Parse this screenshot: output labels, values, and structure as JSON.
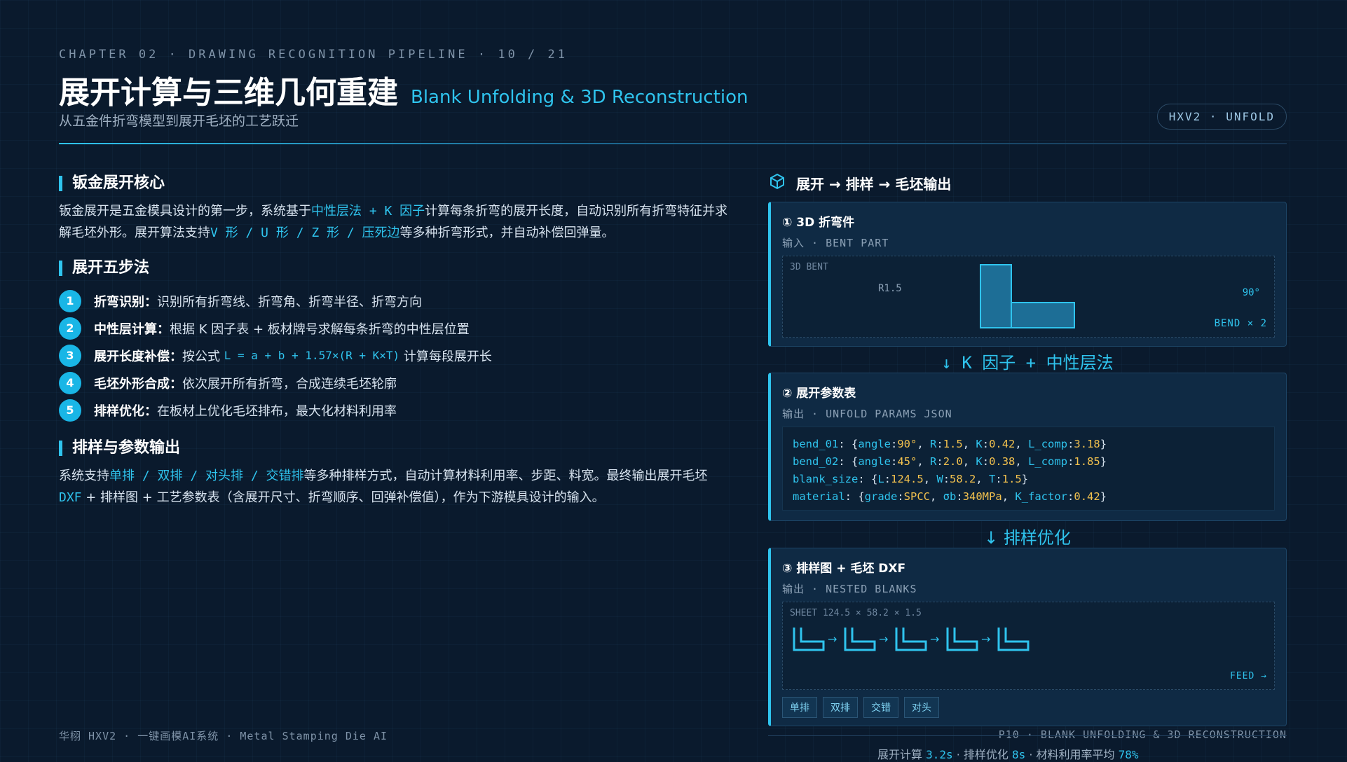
{
  "header": {
    "chapter": "CHAPTER 02 · DRAWING RECOGNITION PIPELINE · 10 / 21",
    "title_cn": "展开计算与三维几何重建",
    "title_en": "Blank Unfolding & 3D Reconstruction",
    "subtitle": "从五金件折弯模型到展开毛坯的工艺跃迁",
    "badge": "HXV2 · UNFOLD"
  },
  "left": {
    "sec1_title": "钣金展开核心",
    "sec1_p1a": "钣金展开是五金模具设计的第一步，系统基于",
    "sec1_p1_hl1": "中性层法 + K 因子",
    "sec1_p1b": "计算每条折弯的展开长度，自动识别所有折弯特征并求解毛坯外形。展开算法支持",
    "sec1_p1_hl2": "V 形 / U 形 / Z 形 / 压死边",
    "sec1_p1c": "等多种折弯形式，并自动补偿回弹量。",
    "sec2_title": "展开五步法",
    "steps": [
      {
        "n": "1",
        "label": "折弯识别：",
        "text": "识别所有折弯线、折弯角、折弯半径、折弯方向"
      },
      {
        "n": "2",
        "label": "中性层计算：",
        "text": "根据 K 因子表 + 板材牌号求解每条折弯的中性层位置"
      },
      {
        "n": "3",
        "label": "展开长度补偿：",
        "text": "按公式",
        "formula": "L = a + b + 1.57×(R + K×T)",
        "text2": "计算每段展开长"
      },
      {
        "n": "4",
        "label": "毛坯外形合成：",
        "text": "依次展开所有折弯，合成连续毛坯轮廓"
      },
      {
        "n": "5",
        "label": "排样优化：",
        "text": "在板材上优化毛坯排布，最大化材料利用率"
      }
    ],
    "sec3_title": "排样与参数输出",
    "sec3_p_a": "系统支持",
    "sec3_p_hl1": "单排 / 双排 / 对头排 / 交错排",
    "sec3_p_b": "等多种排样方式，自动计算材料利用率、步距、料宽。最终输出展开毛坯",
    "sec3_p_hl2": "DXF",
    "sec3_p_c": "+ 排样图 + 工艺参数表（含展开尺寸、折弯顺序、回弹补偿值），作为下游模具设计的输入。"
  },
  "right": {
    "head": "展开 → 排样 → 毛坯输出",
    "card1": {
      "title": "① 3D 折弯件",
      "sub": "输入 · BENT PART",
      "label": "3D BENT",
      "r": "R1.5",
      "angle": "90°",
      "bend": "BEND × 2"
    },
    "arrow1": "↓ K 因子 + 中性层法",
    "card2": {
      "title": "② 展开参数表",
      "sub": "输出 · UNFOLD PARAMS JSON"
    },
    "code": [
      {
        "k": "bend_01",
        "parts": [
          [
            "angle",
            "90°"
          ],
          [
            "R",
            "1.5"
          ],
          [
            "K",
            "0.42"
          ],
          [
            "L_comp",
            "3.18"
          ]
        ]
      },
      {
        "k": "bend_02",
        "parts": [
          [
            "angle",
            "45°"
          ],
          [
            "R",
            "2.0"
          ],
          [
            "K",
            "0.38"
          ],
          [
            "L_comp",
            "1.85"
          ]
        ]
      },
      {
        "k": "blank_size",
        "parts": [
          [
            "L",
            "124.5"
          ],
          [
            "W",
            "58.2"
          ],
          [
            "T",
            "1.5"
          ]
        ]
      },
      {
        "k": "material",
        "parts": [
          [
            "grade",
            "SPCC"
          ],
          [
            "σb",
            "340MPa"
          ],
          [
            "K_factor",
            "0.42"
          ]
        ]
      }
    ],
    "arrow2": "↓ 排样优化",
    "card3": {
      "title": "③ 排样图 + 毛坯 DXF",
      "sub": "输出 · NESTED BLANKS",
      "sheet": "SHEET 124.5 × 58.2 × 1.5",
      "feed": "FEED →"
    },
    "tags": [
      "单排",
      "双排",
      "交错",
      "对头"
    ]
  },
  "footer": {
    "left": "华栩 HXV2 · 一键画模AI系统 · Metal Stamping Die AI",
    "right": "P10 · BLANK UNFOLDING & 3D RECONSTRUCTION",
    "s1": "展开计算",
    "v1": "3.2s",
    "s2": "排样优化",
    "v2": "8s",
    "s3": "材料利用率平均",
    "v3": "78%"
  }
}
